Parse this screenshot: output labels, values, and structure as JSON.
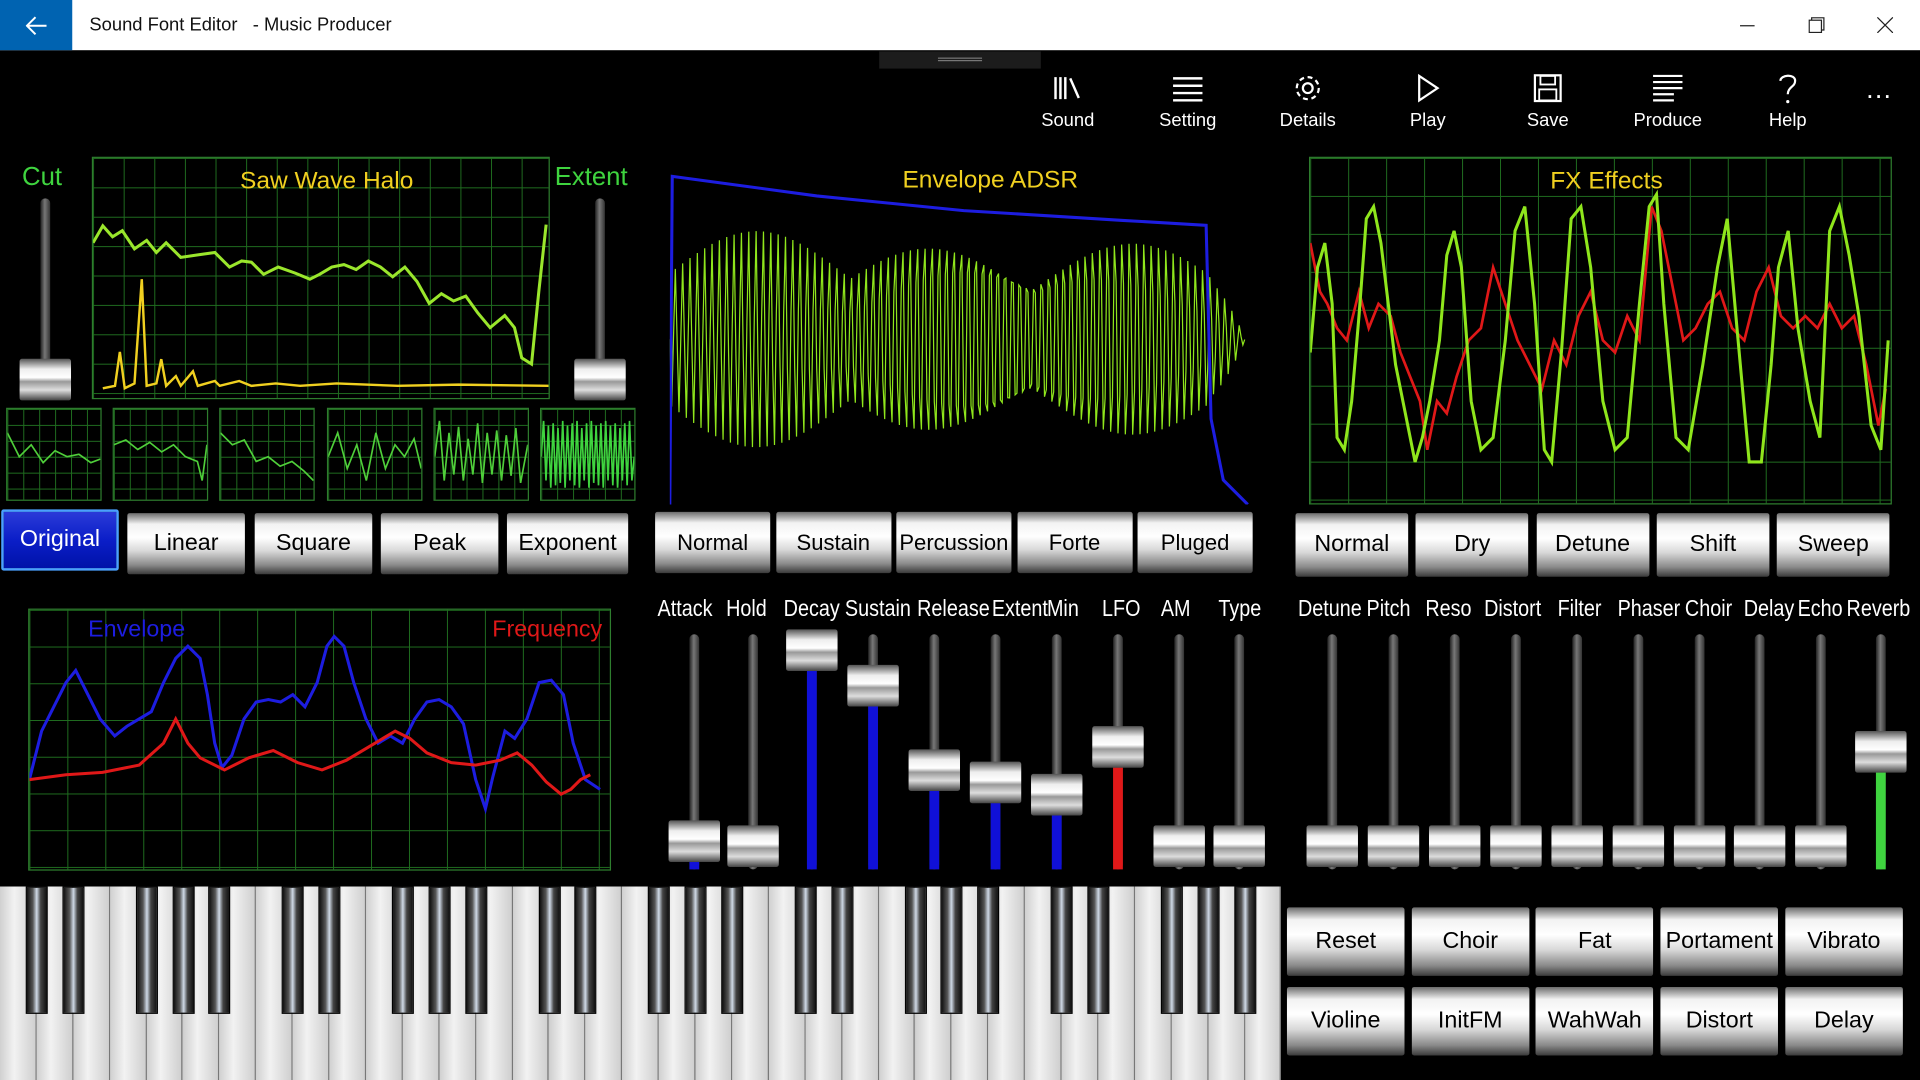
{
  "window": {
    "title": "Sound Font Editor   - Music Producer",
    "back_icon": "arrow-left-icon"
  },
  "toolbar": [
    {
      "label": "Sound",
      "icon": "library-icon"
    },
    {
      "label": "Setting",
      "icon": "list-icon"
    },
    {
      "label": "Details",
      "icon": "gear-icon"
    },
    {
      "label": "Play",
      "icon": "play-icon"
    },
    {
      "label": "Save",
      "icon": "save-icon"
    },
    {
      "label": "Produce",
      "icon": "document-icon"
    },
    {
      "label": "Help",
      "icon": "help-icon"
    }
  ],
  "more_label": "...",
  "halo": {
    "title": "Saw Wave Halo",
    "cut_label": "Cut",
    "extent_label": "Extent",
    "cut_level": 0.1,
    "extent_level": 0.1
  },
  "wave_buttons": [
    {
      "label": "Original",
      "selected": true
    },
    {
      "label": "Linear"
    },
    {
      "label": "Square"
    },
    {
      "label": "Peak"
    },
    {
      "label": "Exponent"
    }
  ],
  "env_freq": {
    "envelope_label": "Envelope",
    "frequency_label": "Frequency"
  },
  "adsr": {
    "title": "Envelope ADSR",
    "modes": [
      "Normal",
      "Sustain",
      "Percussion",
      "Forte",
      "Pluged"
    ],
    "sliders": [
      {
        "label": "Attack",
        "level": 0.12
      },
      {
        "label": "Hold",
        "level": 0.1
      },
      {
        "label": "Decay",
        "level": 0.93
      },
      {
        "label": "Sustain",
        "level": 0.78
      },
      {
        "label": "Release",
        "level": 0.42
      },
      {
        "label": "Extent",
        "level": 0.37
      },
      {
        "label": "Min",
        "level": 0.32
      },
      {
        "label": "LFO",
        "level": 0.52
      },
      {
        "label": "AM",
        "level": 0.1
      },
      {
        "label": "Type",
        "level": 0.1
      }
    ]
  },
  "fx": {
    "title": "FX Effects",
    "modes": [
      "Normal",
      "Dry",
      "Detune",
      "Shift",
      "Sweep"
    ],
    "sliders": [
      {
        "label": "Detune",
        "level": 0.1
      },
      {
        "label": "Pitch",
        "level": 0.1
      },
      {
        "label": "Reso",
        "level": 0.1
      },
      {
        "label": "Distort",
        "level": 0.1
      },
      {
        "label": "Filter",
        "level": 0.1
      },
      {
        "label": "Phaser",
        "level": 0.1
      },
      {
        "label": "Choir",
        "level": 0.1
      },
      {
        "label": "Delay",
        "level": 0.1
      },
      {
        "label": "Echo",
        "level": 0.1
      },
      {
        "label": "Reverb",
        "level": 0.5
      }
    ]
  },
  "presets": [
    "Reset",
    "Choir",
    "Fat",
    "Portament",
    "Vibrato",
    "Violine",
    "InitFM",
    "WahWah",
    "Distort",
    "Delay"
  ],
  "colors": {
    "accent": "#0063b1",
    "green": "#3fd43f",
    "yellow": "#f0d020",
    "blue": "#1010d8",
    "red": "#e01818",
    "lime": "#8fe61c"
  }
}
